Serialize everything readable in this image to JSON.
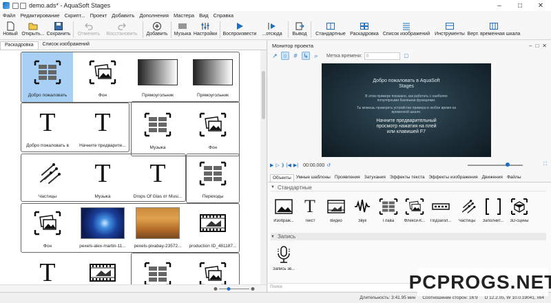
{
  "window": {
    "title": "demo.ads* - AquaSoft Stages"
  },
  "menu": [
    "Файл",
    "Редактирование",
    "Скрипт...",
    "Проект",
    "Добавить",
    "Дополнения",
    "Мастера",
    "Вид",
    "Справка"
  ],
  "toolbar": {
    "items": [
      {
        "label": "Новый",
        "icon": "new-file-icon",
        "disabled": false
      },
      {
        "label": "Открыть...",
        "icon": "open-folder-icon",
        "disabled": false
      },
      {
        "label": "Сохранить",
        "icon": "save-icon",
        "disabled": false
      },
      {
        "label": "Отменить",
        "icon": "undo-icon",
        "disabled": true
      },
      {
        "label": "Восстановить",
        "icon": "redo-icon",
        "disabled": true
      },
      {
        "label": "Добавить",
        "icon": "add-icon",
        "disabled": false
      },
      {
        "label": "Музыка",
        "icon": "music-icon",
        "disabled": false
      },
      {
        "label": "Настройки",
        "icon": "settings-icon",
        "disabled": false
      },
      {
        "label": "Воспроизвести",
        "icon": "play-icon",
        "disabled": false
      },
      {
        "label": "...отсюда",
        "icon": "play-from-here-icon",
        "disabled": false
      },
      {
        "label": "Вывод",
        "icon": "output-icon",
        "disabled": false
      },
      {
        "label": "Стандартные",
        "icon": "standard-layout-icon",
        "disabled": false
      },
      {
        "label": "Раскадровка",
        "icon": "storyboard-icon",
        "disabled": false
      },
      {
        "label": "Список изображений",
        "icon": "image-list-icon",
        "disabled": false
      },
      {
        "label": "Инструменты",
        "icon": "tools-icon",
        "disabled": false
      },
      {
        "label": "Верт. временная шкала",
        "icon": "vertical-timeline-icon",
        "disabled": false
      }
    ]
  },
  "left": {
    "tabs": [
      "Раскадровка",
      "Список изображений"
    ],
    "tiles": [
      {
        "label": "Добро пожаловать",
        "kind": "chapter",
        "selected": true
      },
      {
        "label": "Фон",
        "kind": "image"
      },
      {
        "label": "Прямоугольник",
        "kind": "gradient"
      },
      {
        "label": "Прямоугольник",
        "kind": "gradient"
      },
      {
        "label": "Добро пожаловать в",
        "kind": "text"
      },
      {
        "label": "Начните предварите...",
        "kind": "text"
      },
      {
        "label": "Музыка",
        "kind": "chapter"
      },
      {
        "label": "Фон",
        "kind": "image"
      },
      {
        "label": "Частицы",
        "kind": "particles"
      },
      {
        "label": "Музыка",
        "kind": "text"
      },
      {
        "label": "Drops Of Glas от Musi...",
        "kind": "text"
      },
      {
        "label": "Переходы",
        "kind": "chapter"
      },
      {
        "label": "Фон",
        "kind": "image"
      },
      {
        "label": "pexels-alex-martin-11...",
        "kind": "photo-blue"
      },
      {
        "label": "pexels-pixabay-23572...",
        "kind": "photo-autumn"
      },
      {
        "label": "production ID_481187...",
        "kind": "film"
      },
      {
        "label": "",
        "kind": "text"
      },
      {
        "label": "",
        "kind": "film"
      },
      {
        "label": "",
        "kind": "chapter"
      },
      {
        "label": "",
        "kind": "image"
      }
    ]
  },
  "monitor": {
    "title": "Монитор проекта",
    "timemark_label": "Метка времени:",
    "timemark_value": "0",
    "preview": {
      "title": "Добро пожаловать в AquaSoft Stages",
      "text1": "В этом примере показано, как работать с наиболее популярными базовыми функциями.",
      "text2": "Ты можешь проверить устройство примера в любое время на временной шкале.",
      "text3": "Начните предварительный просмотр нажатия на плей или клавишей F7"
    },
    "time": "00:00.000"
  },
  "objects": {
    "tabs": [
      "Объекты",
      "Умные шаблоны",
      "Проявления",
      "Затухания",
      "Эффекты текста",
      "Эффекты изображения",
      "Движения",
      "Файлы"
    ],
    "sections": [
      "Стандартные",
      "Запись"
    ],
    "standard": [
      {
        "label": "Изображ...",
        "icon": "image-icon"
      },
      {
        "label": "Текст",
        "icon": "text-icon"
      },
      {
        "label": "Видео",
        "icon": "video-icon"
      },
      {
        "label": "Звук",
        "icon": "sound-icon"
      },
      {
        "label": "Глава",
        "icon": "chapter-icon"
      },
      {
        "label": "Флекси-К...",
        "icon": "flexi-collage-icon"
      },
      {
        "label": "Подзагол...",
        "icon": "subtitle-icon"
      },
      {
        "label": "Частицы",
        "icon": "particles-icon"
      },
      {
        "label": "Заполнит...",
        "icon": "placeholder-icon"
      },
      {
        "label": "3D-сцены",
        "icon": "3d-scene-icon"
      }
    ],
    "record": [
      {
        "label": "Запись зв...",
        "icon": "microphone-icon"
      }
    ],
    "search_placeholder": "Поиск"
  },
  "status": {
    "duration": "Длительность: 3:41.95 мин",
    "aspect": "Соотношение сторон: 16:9",
    "version": "D 12.2.05, W 10.0.19041, x64"
  },
  "watermark": "PCPROGS.NET"
}
